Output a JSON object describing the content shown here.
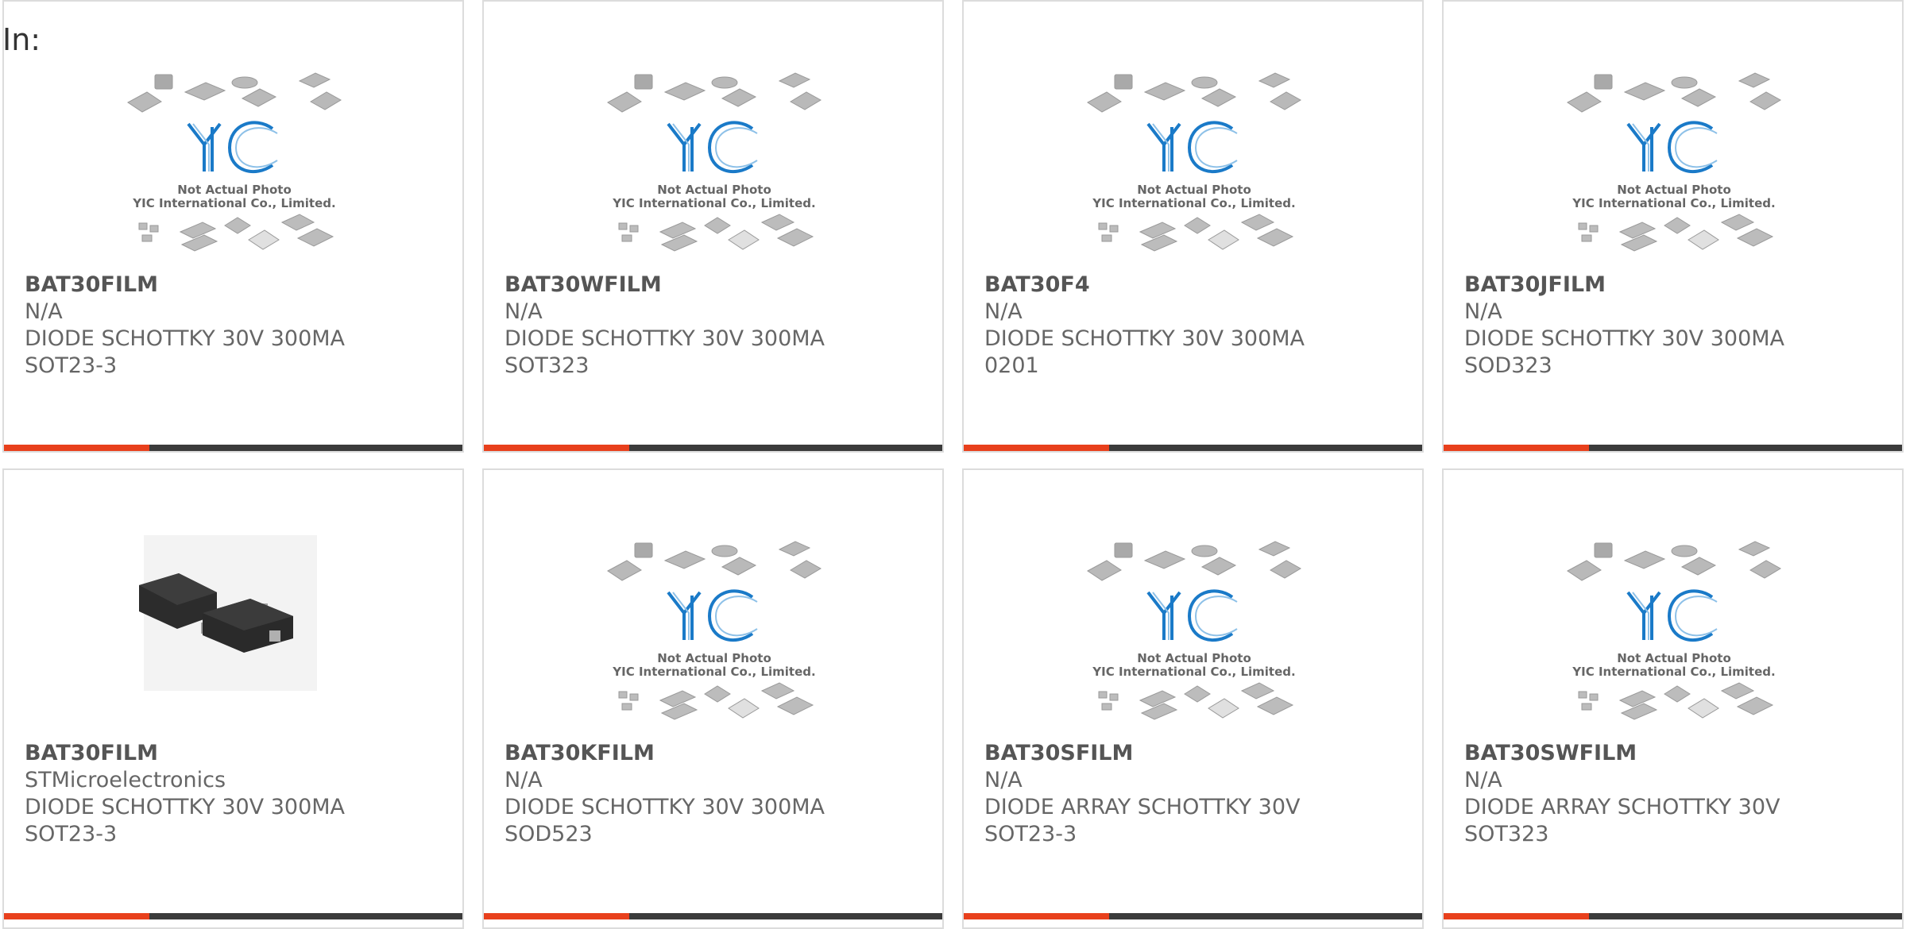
{
  "header": {
    "in_label": "In:"
  },
  "placeholder": {
    "logo_text": "YIC",
    "caption_line1": "Not Actual Photo",
    "caption_line2": "YIC International Co., Limited."
  },
  "colors": {
    "accent": "#e8401c",
    "bar": "#3b3b3b",
    "logo_blue": "#1a7ac8"
  },
  "products": [
    {
      "part": "BAT30FILM",
      "maker": "N/A",
      "desc": "DIODE SCHOTTKY 30V 300MA",
      "package": "SOT23-3",
      "image": "placeholder"
    },
    {
      "part": "BAT30WFILM",
      "maker": "N/A",
      "desc": "DIODE SCHOTTKY 30V 300MA",
      "package": "SOT323",
      "image": "placeholder"
    },
    {
      "part": "BAT30F4",
      "maker": "N/A",
      "desc": "DIODE SCHOTTKY 30V 300MA",
      "package": "0201",
      "image": "placeholder"
    },
    {
      "part": "BAT30JFILM",
      "maker": "N/A",
      "desc": "DIODE SCHOTTKY 30V 300MA",
      "package": "SOD323",
      "image": "placeholder"
    },
    {
      "part": "BAT30FILM",
      "maker": "STMicroelectronics",
      "desc": "DIODE SCHOTTKY 30V 300MA",
      "package": "SOT23-3",
      "image": "sot23-photo"
    },
    {
      "part": "BAT30KFILM",
      "maker": "N/A",
      "desc": "DIODE SCHOTTKY 30V 300MA",
      "package": "SOD523",
      "image": "placeholder"
    },
    {
      "part": "BAT30SFILM",
      "maker": "N/A",
      "desc": "DIODE ARRAY SCHOTTKY 30V",
      "package": "SOT23-3",
      "image": "placeholder"
    },
    {
      "part": "BAT30SWFILM",
      "maker": "N/A",
      "desc": "DIODE ARRAY SCHOTTKY 30V",
      "package": "SOT323",
      "image": "placeholder"
    }
  ]
}
